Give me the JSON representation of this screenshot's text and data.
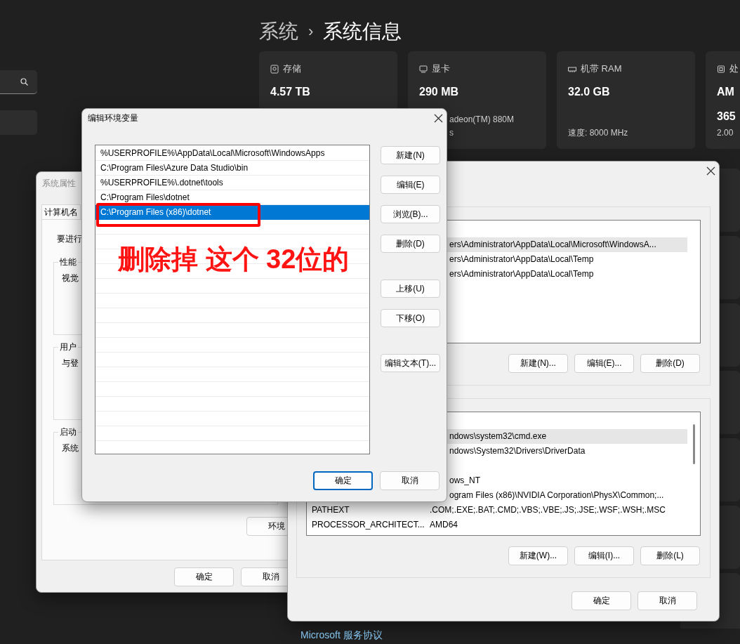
{
  "settings": {
    "breadcrumb_parent": "系统",
    "separator": "›",
    "title": "系统信息",
    "cards": [
      {
        "kind": "storage",
        "label": "存储",
        "value": [
          "4.57 TB"
        ]
      },
      {
        "kind": "gpu",
        "label": "显卡",
        "value": [
          "290 MB"
        ],
        "detail": [
          "adeon(TM) 880M",
          "s"
        ],
        "covered": true
      },
      {
        "kind": "memory",
        "label": "机带 RAM",
        "value": [
          "32.0 GB"
        ],
        "detail": [
          "速度: 8000 MHz"
        ],
        "covered": false
      },
      {
        "kind": "cpu",
        "label": "处",
        "value": [
          "AM",
          "365"
        ],
        "detail": [
          "2.00"
        ],
        "covered": false
      }
    ],
    "footer_link": "Microsoft 服务协议"
  },
  "system_properties": {
    "title": "系统属性",
    "tabs": [
      {
        "label": "计算机名",
        "selected": true
      }
    ],
    "intro": "要进行",
    "groups": [
      {
        "legend": "性能",
        "text": "视觉"
      },
      {
        "legend": "用户",
        "text": "与登"
      },
      {
        "legend": "启动",
        "text": "系统"
      }
    ],
    "env_button": "环境",
    "buttons": [
      "确定",
      "取消"
    ]
  },
  "environment_variables": {
    "user_vars": {
      "rows": [
        {
          "selected": false
        },
        {
          "value": "ers\\Administrator\\AppData\\Local\\Microsoft\\WindowsA...",
          "covered": true,
          "selected": true
        },
        {
          "value": "ers\\Administrator\\AppData\\Local\\Temp",
          "covered": true,
          "selected": false
        },
        {
          "value": "ers\\Administrator\\AppData\\Local\\Temp",
          "covered": true,
          "selected": false
        }
      ],
      "buttons": [
        "新建(N)...",
        "编辑(E)...",
        "删除(D)"
      ]
    },
    "system_vars": {
      "rows": [
        {
          "selected": false
        },
        {
          "value": "ndows\\system32\\cmd.exe",
          "covered": true,
          "selected": true
        },
        {
          "value": "ndows\\System32\\Drivers\\DriverData",
          "covered": true,
          "selected": false
        },
        {
          "selected": false
        },
        {
          "value": "ows_NT",
          "covered": true,
          "selected": false
        },
        {
          "value": "ogram Files (x86)\\NVIDIA Corporation\\PhysX\\Common;...",
          "covered": true,
          "selected": false
        },
        {
          "name": "PATHEXT",
          "value": ".COM;.EXE;.BAT;.CMD;.VBS;.VBE;.JS;.JSE;.WSF;.WSH;.MSC",
          "selected": false
        },
        {
          "name": "PROCESSOR_ARCHITECT...",
          "value": "AMD64",
          "selected": false
        }
      ],
      "buttons": [
        "新建(W)...",
        "编辑(I)...",
        "删除(L)"
      ]
    },
    "buttons": [
      "确定",
      "取消"
    ]
  },
  "edit_dialog": {
    "title": "编辑环境变量",
    "entries": [
      {
        "value": "%USERPROFILE%\\AppData\\Local\\Microsoft\\WindowsApps",
        "selected": false
      },
      {
        "value": "C:\\Program Files\\Azure Data Studio\\bin",
        "selected": false
      },
      {
        "value": "%USERPROFILE%\\.dotnet\\tools",
        "selected": false
      },
      {
        "value": "C:\\Program Files\\dotnet",
        "selected": false
      },
      {
        "value": "C:\\Program Files (x86)\\dotnet",
        "selected": true
      }
    ],
    "side_button_groups": [
      [
        "新建(N)",
        "编辑(E)",
        "浏览(B)...",
        "删除(D)"
      ],
      [
        "上移(U)",
        "下移(O)"
      ],
      [
        "编辑文本(T)..."
      ]
    ],
    "buttons": [
      {
        "label": "确定",
        "default": true
      },
      {
        "label": "取消",
        "default": false
      }
    ]
  },
  "annotation": {
    "text": "删除掉 这个 32位的"
  }
}
